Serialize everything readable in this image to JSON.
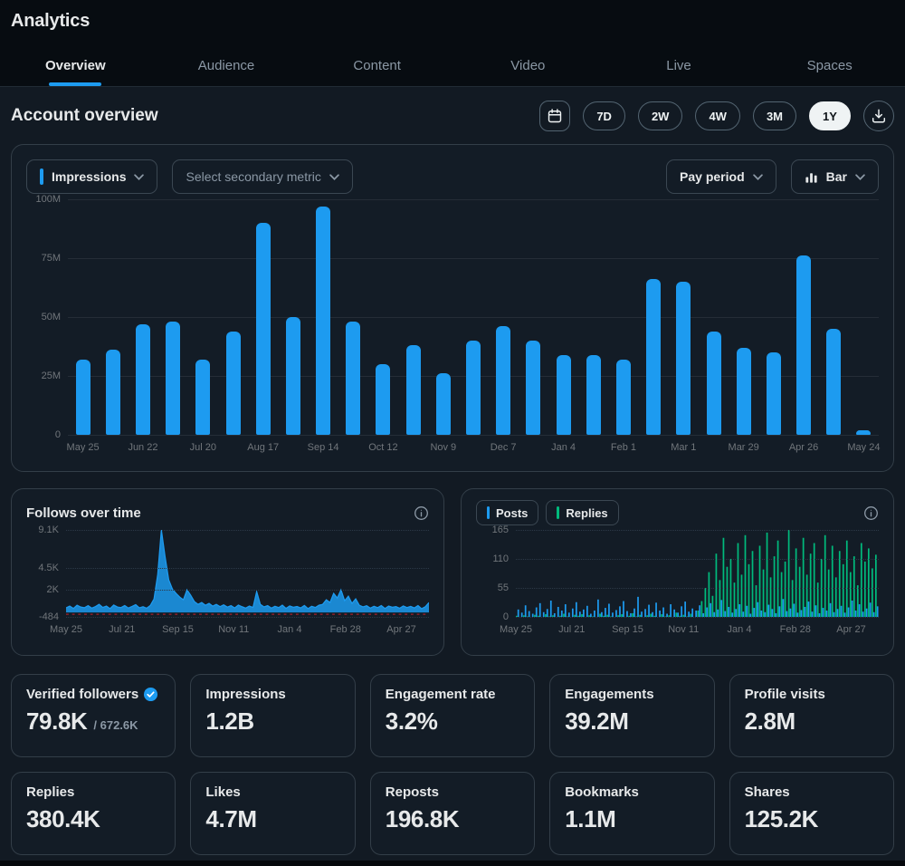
{
  "page": {
    "title": "Analytics"
  },
  "tabs": [
    {
      "label": "Overview",
      "active": true
    },
    {
      "label": "Audience",
      "active": false
    },
    {
      "label": "Content",
      "active": false
    },
    {
      "label": "Video",
      "active": false
    },
    {
      "label": "Live",
      "active": false
    },
    {
      "label": "Spaces",
      "active": false
    }
  ],
  "section": {
    "title": "Account overview"
  },
  "range": {
    "options": [
      "7D",
      "2W",
      "4W",
      "3M",
      "1Y"
    ],
    "active": "1Y"
  },
  "icons": {
    "calendar": "calendar-icon",
    "download": "download-icon",
    "chevron": "chevron-down-icon",
    "chart_type": "bar-chart-icon",
    "info": "info-icon",
    "verified": "verified-badge-icon"
  },
  "controls": {
    "primary_metric": "Impressions",
    "secondary_metric_placeholder": "Select secondary metric",
    "period": "Pay period",
    "chart_type": "Bar"
  },
  "colors": {
    "accent": "#1d9bf0",
    "green": "#00ba7c",
    "negative_line": "#f4212e"
  },
  "chart_data": [
    {
      "name": "impressions-by-period",
      "type": "bar",
      "title": "Impressions",
      "unit": "M",
      "ylim": [
        0,
        100
      ],
      "yticks": [
        "100M",
        "75M",
        "50M",
        "25M",
        "0"
      ],
      "tick_labels": [
        "May 25",
        "Jun 22",
        "Jul 20",
        "Aug 17",
        "Sep 14",
        "Oct 12",
        "Nov 9",
        "Dec 7",
        "Jan 4",
        "Feb 1",
        "Mar 1",
        "Mar 29",
        "Apr 26",
        "May 24"
      ],
      "values": [
        32,
        36,
        47,
        48,
        32,
        44,
        90,
        50,
        97,
        48,
        30,
        38,
        26,
        40,
        46,
        40,
        34,
        34,
        32,
        66,
        65,
        44,
        37,
        35,
        76,
        45,
        2
      ],
      "bar_color": "#1d9bf0",
      "grid": true
    },
    {
      "name": "follows-over-time",
      "type": "area",
      "title": "Follows over time",
      "ylim": [
        -484,
        9100
      ],
      "yticks": [
        "9.1K",
        "4.5K",
        "2K",
        "-484"
      ],
      "ytick_pos": [
        0,
        0.44,
        0.69,
        1
      ],
      "xticks": [
        "May 25",
        "Jul 21",
        "Sep 15",
        "Nov 11",
        "Jan 4",
        "Feb 28",
        "Apr 27"
      ],
      "line_color": "#1d9bf0",
      "zero_line_color": "#f4212e",
      "values": [
        500,
        700,
        450,
        800,
        600,
        520,
        750,
        480,
        650,
        900,
        560,
        700,
        430,
        820,
        610,
        540,
        760,
        490,
        680,
        870,
        520,
        640,
        470,
        780,
        1500,
        4200,
        9100,
        6200,
        3600,
        2600,
        2100,
        1700,
        1400,
        2500,
        1900,
        1200,
        900,
        1100,
        800,
        1000,
        700,
        900,
        650,
        850,
        600,
        750,
        500,
        820,
        640,
        480,
        700,
        560,
        2300,
        900,
        620,
        750,
        480,
        690,
        540,
        810,
        460,
        720,
        580,
        660,
        500,
        770,
        430,
        690,
        550,
        800,
        900,
        1400,
        1100,
        2100,
        1600,
        2500,
        1300,
        1800,
        1000,
        1500,
        800,
        620,
        740,
        480,
        690,
        530,
        760,
        440,
        700,
        580,
        650,
        470,
        720,
        540,
        680,
        500,
        760,
        420,
        640,
        1100
      ]
    },
    {
      "name": "posts-and-replies",
      "type": "bar",
      "legend": [
        {
          "label": "Posts",
          "color": "#1d9bf0"
        },
        {
          "label": "Replies",
          "color": "#00ba7c"
        }
      ],
      "ylim": [
        0,
        165
      ],
      "yticks": [
        "165",
        "110",
        "55",
        "0"
      ],
      "xticks": [
        "May 25",
        "Jul 21",
        "Sep 15",
        "Nov 11",
        "Jan 4",
        "Feb 28",
        "Apr 27"
      ],
      "series": [
        {
          "name": "Posts",
          "color": "#1d9bf0",
          "values": [
            14,
            8,
            22,
            11,
            6,
            18,
            26,
            9,
            15,
            31,
            7,
            19,
            12,
            24,
            8,
            16,
            28,
            10,
            14,
            21,
            6,
            12,
            33,
            9,
            17,
            25,
            8,
            13,
            20,
            30,
            11,
            7,
            16,
            38,
            10,
            15,
            23,
            9,
            27,
            12,
            18,
            6,
            24,
            14,
            8,
            20,
            29,
            10,
            16,
            12,
            22,
            7,
            18,
            26,
            9,
            14,
            32,
            11,
            19,
            8,
            15,
            24,
            10,
            21,
            6,
            17,
            28,
            12,
            9,
            23,
            15,
            7,
            20,
            34,
            11,
            16,
            25,
            8,
            13,
            19,
            29,
            10,
            22,
            7,
            17,
            12,
            26,
            9,
            15,
            21,
            8,
            18,
            31,
            12,
            24,
            10,
            16,
            27,
            9,
            20
          ]
        },
        {
          "name": "Replies",
          "color": "#00ba7c",
          "values": [
            2,
            0,
            3,
            1,
            0,
            4,
            2,
            0,
            5,
            1,
            3,
            0,
            2,
            6,
            1,
            0,
            4,
            2,
            5,
            0,
            3,
            1,
            0,
            6,
            2,
            4,
            1,
            0,
            3,
            5,
            0,
            2,
            7,
            1,
            4,
            0,
            3,
            6,
            2,
            0,
            5,
            1,
            3,
            0,
            8,
            2,
            4,
            1,
            6,
            0,
            12,
            30,
            55,
            85,
            40,
            120,
            70,
            150,
            95,
            110,
            65,
            140,
            80,
            155,
            100,
            125,
            60,
            135,
            90,
            160,
            75,
            115,
            145,
            85,
            105,
            165,
            70,
            130,
            95,
            150,
            80,
            120,
            140,
            65,
            110,
            155,
            90,
            135,
            75,
            125,
            100,
            145,
            85,
            115,
            60,
            140,
            105,
            130,
            92,
            118
          ]
        }
      ]
    }
  ],
  "metrics": {
    "items": [
      {
        "label": "Verified followers",
        "value": "79.8K",
        "suffix": "/ 672.6K",
        "badge": true
      },
      {
        "label": "Impressions",
        "value": "1.2B"
      },
      {
        "label": "Engagement rate",
        "value": "3.2%"
      },
      {
        "label": "Engagements",
        "value": "39.2M"
      },
      {
        "label": "Profile visits",
        "value": "2.8M"
      },
      {
        "label": "Replies",
        "value": "380.4K"
      },
      {
        "label": "Likes",
        "value": "4.7M"
      },
      {
        "label": "Reposts",
        "value": "196.8K"
      },
      {
        "label": "Bookmarks",
        "value": "1.1M"
      },
      {
        "label": "Shares",
        "value": "125.2K"
      }
    ]
  }
}
